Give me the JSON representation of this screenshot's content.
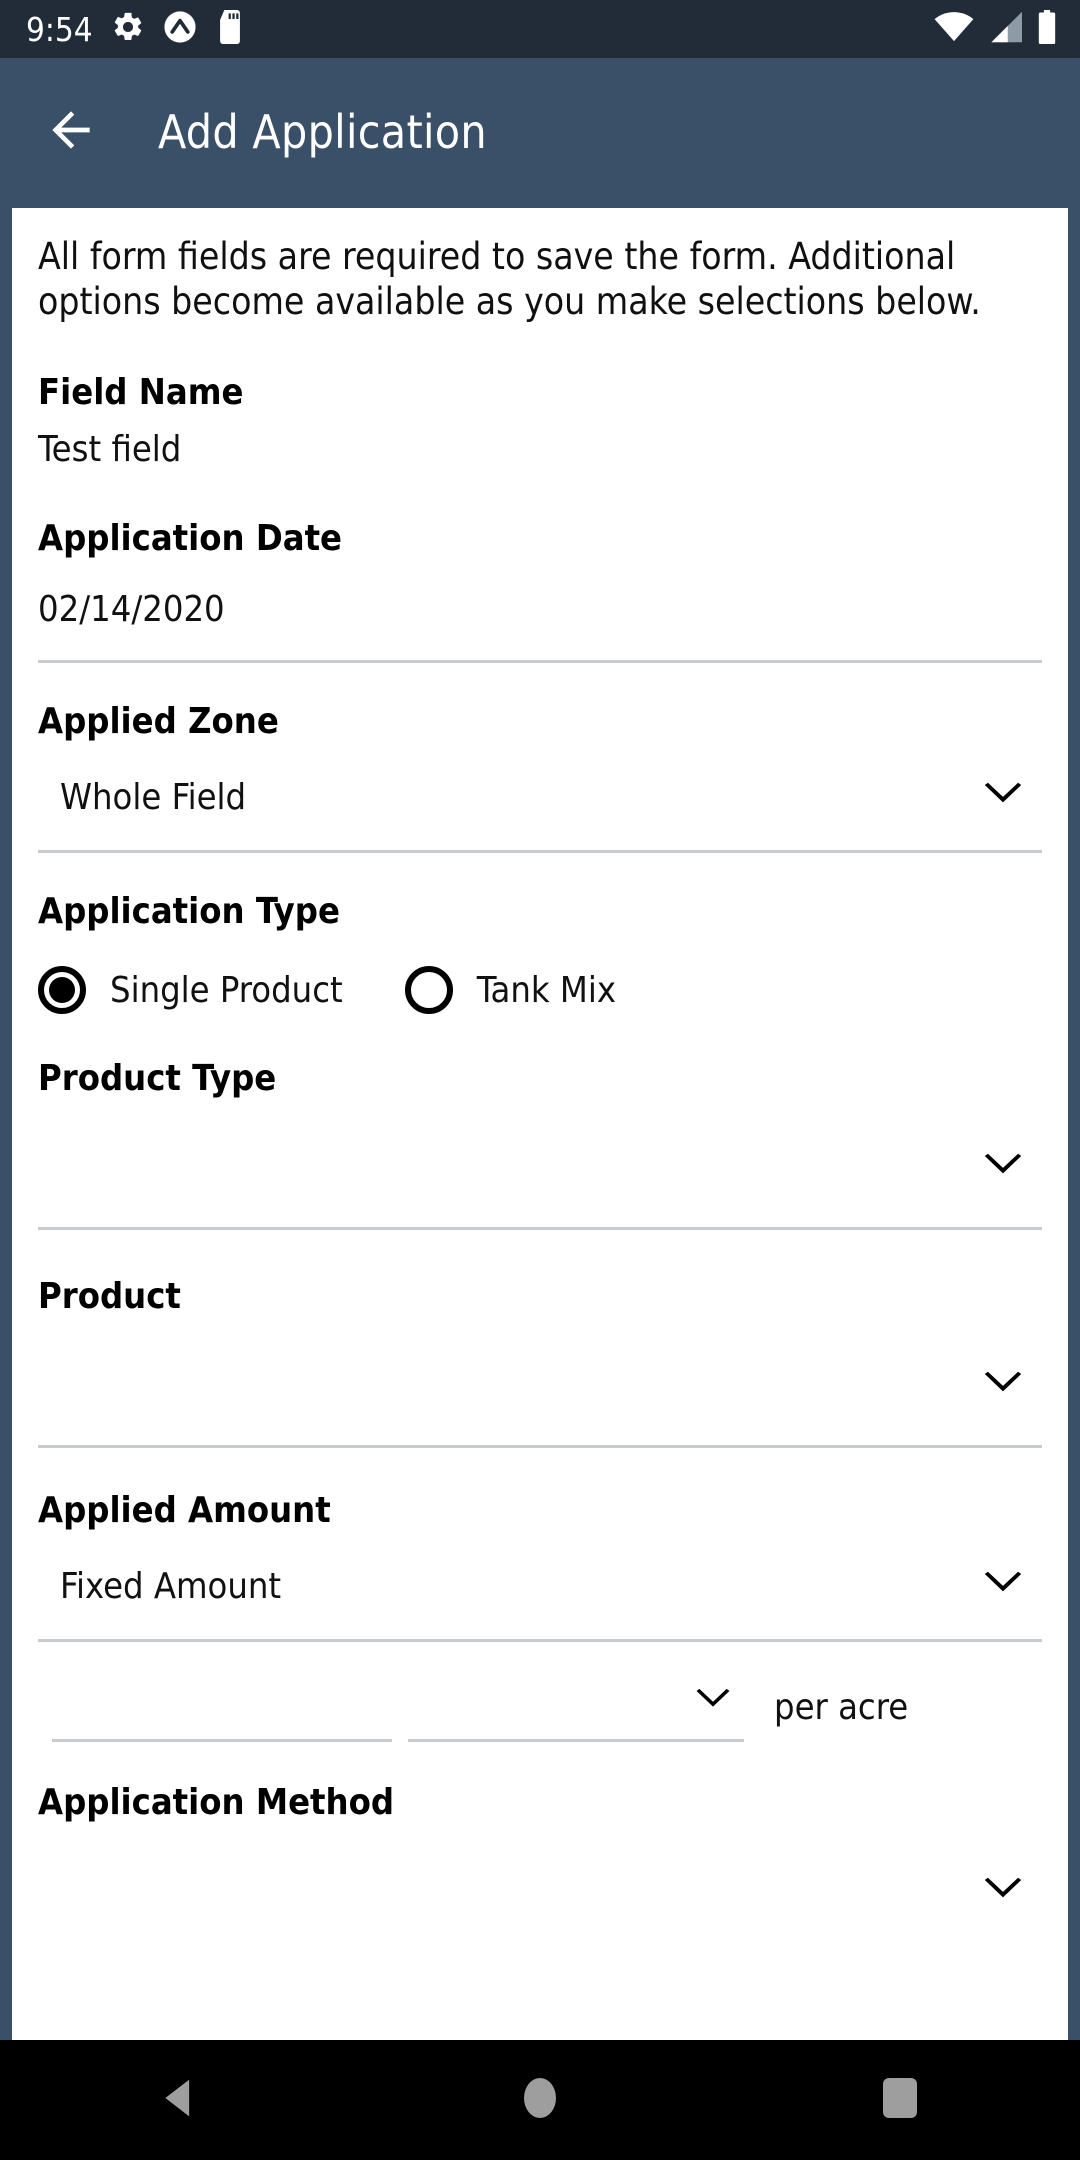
{
  "status_bar": {
    "time": "9:54",
    "icons": [
      "gear-icon",
      "caret-circle-icon",
      "sd-card-icon"
    ],
    "right_icons": [
      "wifi-icon",
      "cellular-signal-icon",
      "battery-icon"
    ],
    "background_color": "#212c38"
  },
  "app_bar": {
    "back_icon": "back-arrow-icon",
    "title": "Add Application",
    "background_color": "#3a4f68",
    "text_color": "#ffffff"
  },
  "form": {
    "intro": "All form fields are required to save the form. Additional options become available as you make selections below.",
    "field_name": {
      "label": "Field Name",
      "value": "Test field"
    },
    "application_date": {
      "label": "Application Date",
      "value": "02/14/2020"
    },
    "applied_zone": {
      "label": "Applied Zone",
      "value": "Whole Field",
      "chevron": "chevron-down-icon"
    },
    "application_type": {
      "label": "Application Type",
      "options": [
        {
          "label": "Single Product",
          "selected": true
        },
        {
          "label": "Tank Mix",
          "selected": false
        }
      ]
    },
    "product_type": {
      "label": "Product Type",
      "value": "",
      "chevron": "chevron-down-icon"
    },
    "product": {
      "label": "Product",
      "value": "",
      "chevron": "chevron-down-icon"
    },
    "applied_amount": {
      "label": "Applied Amount",
      "value": "Fixed Amount",
      "chevron": "chevron-down-icon",
      "amount_value": "",
      "unit_value": "",
      "unit_chevron": "chevron-down-icon",
      "per_unit": "per acre"
    },
    "application_method": {
      "label": "Application Method",
      "value": "",
      "chevron": "chevron-down-icon"
    }
  },
  "nav_bar": {
    "back": "nav-back-icon",
    "home": "nav-home-icon",
    "recents": "nav-recents-icon",
    "background_color": "#000000",
    "icon_color": "#9e9e9e"
  }
}
